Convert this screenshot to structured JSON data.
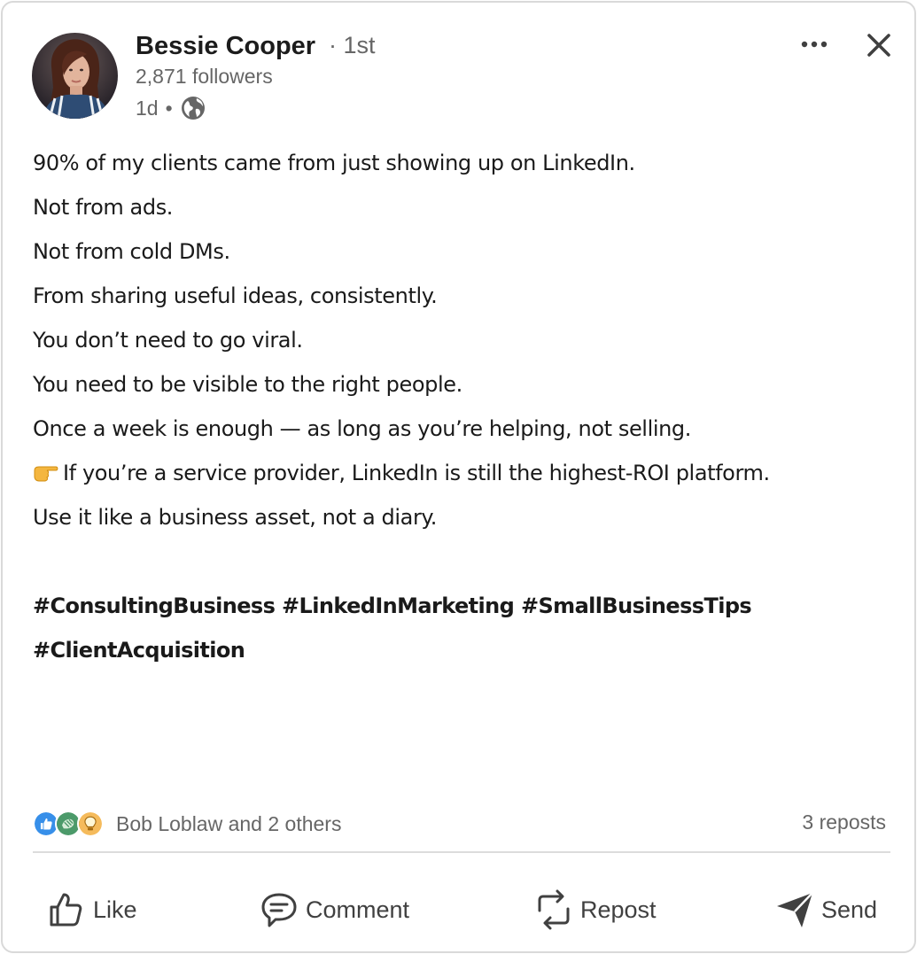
{
  "post": {
    "author": {
      "name": "Bessie Cooper",
      "degree": "· 1st",
      "followers": "2,871 followers",
      "time": "1d",
      "separator": "•",
      "visibility_icon": "globe-icon"
    },
    "body_lines": [
      "90% of my clients came from just showing up on LinkedIn.",
      "Not from ads.",
      "Not from cold DMs.",
      "From sharing useful ideas, consistently.",
      "You don’t need to go viral.",
      "You need to be visible to the right people.",
      "Once a week is enough — as long as you’re helping, not selling.",
      "If you’re a service provider, LinkedIn is still the highest-ROI platform.",
      "Use it like a business asset, not a diary."
    ],
    "pointing_emoji": "👉",
    "hashtags_line1": "#ConsultingBusiness #LinkedInMarketing #SmallBusinessTips",
    "hashtags_line2": "#ClientAcquisition"
  },
  "reactions": {
    "icons": [
      "like-reaction-icon",
      "support-reaction-icon",
      "insightful-reaction-icon"
    ],
    "reactors": "Bob Loblaw and 2 others",
    "reposts": "3 reposts"
  },
  "actions": {
    "like": "Like",
    "comment": "Comment",
    "repost": "Repost",
    "send": "Send"
  },
  "colors": {
    "like_blue": "#378fe9",
    "support_green": "#4c9a6a",
    "insightful_yellow": "#f5bb5c",
    "muted_text": "#666666"
  }
}
